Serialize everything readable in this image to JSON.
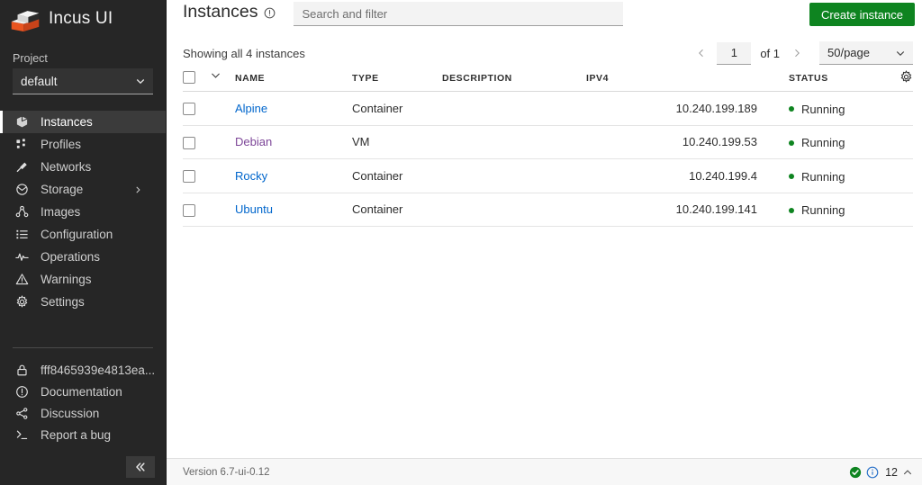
{
  "sidebar": {
    "brand": {
      "name": "Incus UI",
      "logo_icon": "incus-box-logo"
    },
    "project": {
      "label": "Project",
      "value": "default",
      "chevron_icon": "chevron-down-icon"
    },
    "nav_items": [
      {
        "label": "Instances",
        "icon": "cube-icon",
        "active": true
      },
      {
        "label": "Profiles",
        "icon": "profiles-icon",
        "active": false
      },
      {
        "label": "Networks",
        "icon": "network-plug-icon",
        "active": false
      },
      {
        "label": "Storage",
        "icon": "storage-disk-icon",
        "active": false,
        "expand_icon": "chevron-right-icon"
      },
      {
        "label": "Images",
        "icon": "images-share-icon",
        "active": false
      },
      {
        "label": "Configuration",
        "icon": "list-config-icon",
        "active": false
      },
      {
        "label": "Operations",
        "icon": "pulse-icon",
        "active": false
      },
      {
        "label": "Warnings",
        "icon": "warning-triangle-icon",
        "active": false
      },
      {
        "label": "Settings",
        "icon": "gear-icon",
        "active": false
      }
    ],
    "bottom_items": [
      {
        "label": "fff8465939e4813ea...",
        "icon": "lock-icon"
      },
      {
        "label": "Documentation",
        "icon": "info-circle-icon"
      },
      {
        "label": "Discussion",
        "icon": "share-nodes-icon"
      },
      {
        "label": "Report a bug",
        "icon": "terminal-prompt-icon"
      }
    ],
    "collapse_icon": "double-chevron-left-icon"
  },
  "header": {
    "title": "Instances",
    "title_info_icon": "info-circle-icon",
    "search_placeholder": "Search and filter",
    "search_value": "",
    "create_button": "Create instance"
  },
  "list_controls": {
    "showing_text": "Showing all 4 instances",
    "prev_icon": "chevron-left-icon",
    "next_icon": "chevron-right-icon",
    "page_value": "1",
    "page_of": "of 1",
    "per_page": "50/page",
    "per_page_chevron": "chevron-down-icon"
  },
  "table": {
    "select_all_checkbox": false,
    "expand_all_icon": "chevron-down-icon",
    "settings_icon": "gear-icon",
    "columns": [
      {
        "key": "name",
        "label": "NAME"
      },
      {
        "key": "type",
        "label": "TYPE"
      },
      {
        "key": "description",
        "label": "DESCRIPTION"
      },
      {
        "key": "ipv4",
        "label": "IPV4"
      },
      {
        "key": "status",
        "label": "STATUS"
      }
    ],
    "rows": [
      {
        "checked": false,
        "name": "Alpine",
        "visited": false,
        "type": "Container",
        "description": "",
        "ipv4": "10.240.199.189",
        "status": "Running",
        "status_color": "#0e8420"
      },
      {
        "checked": false,
        "name": "Debian",
        "visited": true,
        "type": "VM",
        "description": "",
        "ipv4": "10.240.199.53",
        "status": "Running",
        "status_color": "#0e8420"
      },
      {
        "checked": false,
        "name": "Rocky",
        "visited": false,
        "type": "Container",
        "description": "",
        "ipv4": "10.240.199.4",
        "status": "Running",
        "status_color": "#0e8420"
      },
      {
        "checked": false,
        "name": "Ubuntu",
        "visited": false,
        "type": "Container",
        "description": "",
        "ipv4": "10.240.199.141",
        "status": "Running",
        "status_color": "#0e8420"
      }
    ]
  },
  "footer": {
    "version": "Version 6.7-ui-0.12",
    "success_icon": "check-circle-icon",
    "info_icon": "info-circle-icon",
    "count": "12",
    "chevron_icon": "chevron-up-icon"
  },
  "colors": {
    "sidebar_bg": "#262626",
    "sidebar_active_bg": "#3b3b3b",
    "accent_green": "#0e8420",
    "link_blue": "#0066cc",
    "link_visited": "#7d4698",
    "logo_orange": "#e95420"
  }
}
